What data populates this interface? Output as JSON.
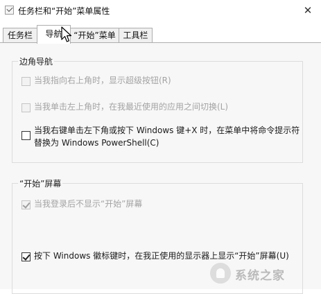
{
  "window": {
    "title": "任务栏和“开始”菜单属性",
    "close_glyph": "✕"
  },
  "tabs": [
    {
      "label": "任务栏",
      "active": false
    },
    {
      "label": "导航",
      "active": true
    },
    {
      "label": "“开始”菜单",
      "active": false
    },
    {
      "label": "工具栏",
      "active": false
    }
  ],
  "corner_group": {
    "title": "边角导航",
    "options": [
      {
        "label": "当我指向右上角时，显示超级按钮(R)",
        "checked": false,
        "enabled": false
      },
      {
        "label": "当我单击左上角时，在我最近使用的应用之间切换(L)",
        "checked": false,
        "enabled": false
      },
      {
        "label_line1": "当我右键单击左下角或按下 Windows 键+X 时，在菜单中将命令提示符",
        "label_line2": "替换为 Windows PowerShell(C)",
        "checked": false,
        "enabled": true
      }
    ]
  },
  "start_group": {
    "title": "“开始”屏幕",
    "options": [
      {
        "label": "当我登录后不显示“开始”屏幕",
        "checked": true,
        "enabled": false
      },
      {
        "label": "按下 Windows 徽标键时，在我正使用的显示器上显示“开始”屏幕(U)",
        "checked": true,
        "enabled": true
      }
    ]
  },
  "watermark": {
    "text": "系统之家"
  }
}
